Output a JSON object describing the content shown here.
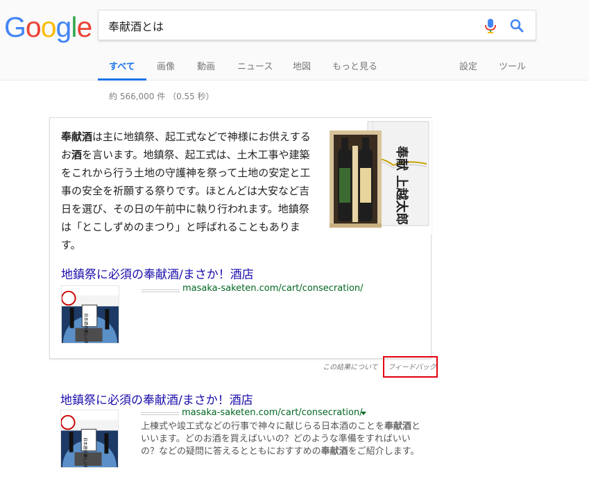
{
  "logo": {
    "letters": [
      "G",
      "o",
      "o",
      "g",
      "l",
      "e"
    ],
    "colors": [
      "#4285f4",
      "#ea4335",
      "#fbbc05",
      "#4285f4",
      "#34a853",
      "#ea4335"
    ]
  },
  "search": {
    "query": "奉献酒とは",
    "mic_icon": "microphone-icon",
    "search_icon": "magnifier-icon"
  },
  "tabs": [
    {
      "label": "すべて",
      "active": true
    },
    {
      "label": "画像"
    },
    {
      "label": "動画"
    },
    {
      "label": "ニュース"
    },
    {
      "label": "地図"
    },
    {
      "label": "もっと見る"
    },
    {
      "label": "設定"
    },
    {
      "label": "ツール"
    }
  ],
  "stats": "約 566,000 件 （0.55 秒）",
  "snippet": {
    "bold1": "奉献酒",
    "text1": "は主に地鎮祭、起工式などで神様にお供えするお",
    "bold2": "酒",
    "text2": "を言います。地鎮祭、起工式は、土木工事や建築をこれから行う土地の守護神を祭って土地の安定と工事の安全を祈願する祭りです。ほとんどは大安など吉日を選び、その日の午前中に執り行われます。地鎮祭は「とこしずめのまつり」と呼ばれることもあります。",
    "image_label": "奉献 上越太郎",
    "source_title": "地鎮祭に必須の奉献酒/まさか！酒店",
    "source_url": "masaka-saketen.com/cart/consecration/",
    "thumb_label": "日本酒の楽しい酔い払い増殖作戦"
  },
  "feedback": {
    "about": "この結果について",
    "link": "フィードバック"
  },
  "result": {
    "title": "地鎮祭に必須の奉献酒/まさか！酒店",
    "url": "masaka-saketen.com/cart/consecration/",
    "desc1": "上棟式や竣工式などの行事で神々に献じらる日本酒のことを",
    "bold1": "奉献酒",
    "desc2": "といいます。どのお酒を買えばいいの？どのような準備をすればいいの？などの疑問に答えるとともにおすすめの",
    "bold2": "奉献酒",
    "desc3": "をご紹介します。"
  }
}
